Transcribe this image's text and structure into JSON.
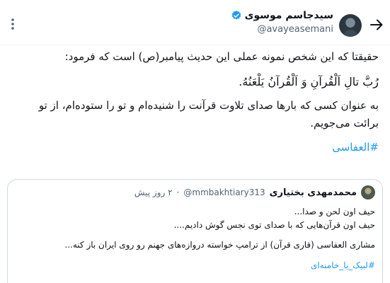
{
  "header": {
    "author_name": "سیدجاسم موسوی",
    "author_handle": "@avayeasemani",
    "verified_color": "#1d9bf0",
    "icons": {
      "back": "arrow-right-icon",
      "more": "more-vertical-icon",
      "verified": "verified-badge-icon"
    }
  },
  "tweet": {
    "line1": "حقیقتا که این شخص نمونه عملی این حدیث پیامبر(ص) است که فرمود:",
    "arabic": "رُبَّ تالِ اَلْقُرآنِ وَ اَلْقُرآنُ يَلْعَنُهُ.",
    "line2": "به عنوان کسی که بارها صدای تلاوت قرآنت را شنیده‌ام و تو را ستوده‌ام، از تو برائت می‌جویم.",
    "hashtag": "#العفاسی",
    "hashtag_color": "#1d9bf0"
  },
  "quote": {
    "name": "محمدمهدی بختیاری",
    "handle": "@mmbakhtiary313",
    "dot": "·",
    "time": "۲ روز پیش",
    "lines": [
      "حیف اون لحن و صدا...",
      "حیف اون قرآن‌هایی که با صدای توی نجس گوش دادیم....",
      "مشاری العفاسی (قاری قرآن) از ترامپ خواسته دروازه‌های جهنم رو روی ایران باز کنه..."
    ],
    "hashtag": "#لبیک_یا_خامنه‌ای"
  }
}
